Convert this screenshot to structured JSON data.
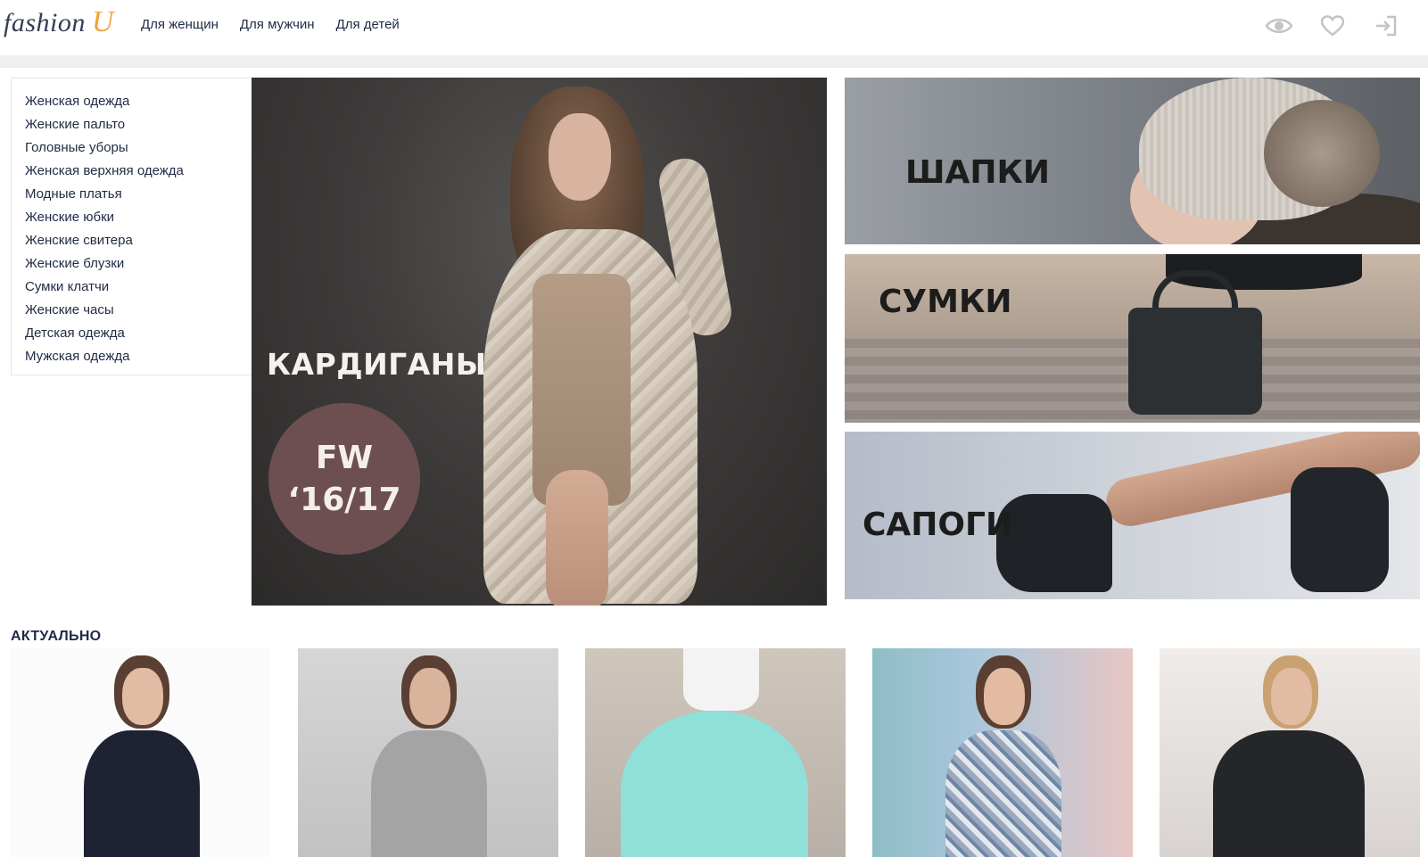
{
  "header": {
    "logo_text": "fashion",
    "logo_accent": "U",
    "nav": [
      "Для женщин",
      "Для мужчин",
      "Для детей"
    ],
    "icons": [
      "eye-icon",
      "heart-icon",
      "login-icon"
    ]
  },
  "categories": [
    "Женская одежда",
    "Женские пальто",
    "Головные уборы",
    "Женская верхняя одежда",
    "Модные платья",
    "Женские юбки",
    "Женские свитера",
    "Женские блузки",
    "Сумки клатчи",
    "Женские часы",
    "Детская одежда",
    "Мужская одежда"
  ],
  "hero": {
    "title": "КАРДИГАНЫ",
    "badge_line1": "FW",
    "badge_line2": "‘16/17"
  },
  "banners": [
    "ШАПКИ",
    "СУМКИ",
    "САПОГИ"
  ],
  "section": {
    "title": "АКТУАЛЬНО"
  },
  "colors": {
    "accent": "#f2a33a",
    "text": "#1f2a44",
    "badge": "#6e4f51",
    "icons": "#c4c4c4"
  }
}
